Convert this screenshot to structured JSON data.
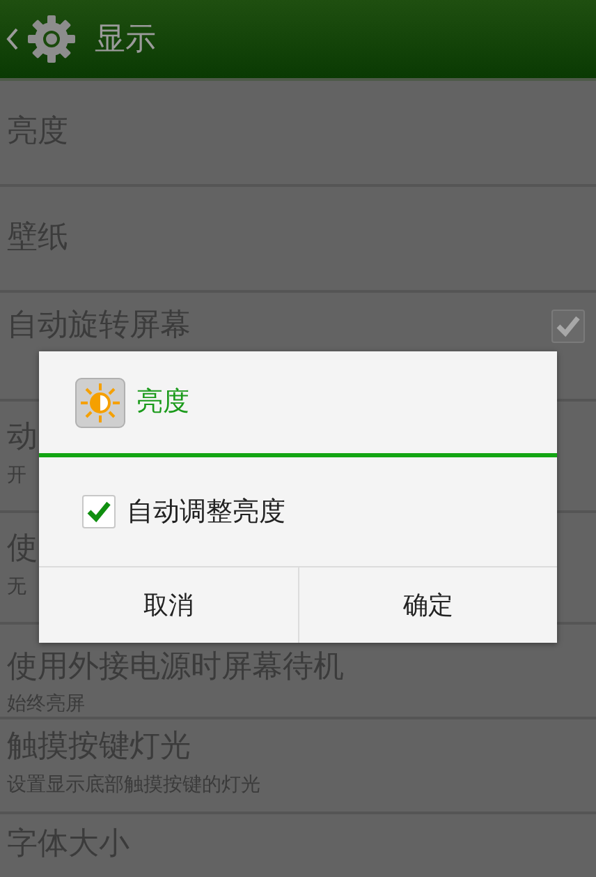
{
  "header": {
    "title": "显示"
  },
  "settings": [
    {
      "title": "亮度"
    },
    {
      "title": "壁纸"
    },
    {
      "title": "自动旋转屏幕",
      "checkbox": {
        "checked": true
      }
    },
    {
      "title": "动",
      "subtitle": "开"
    },
    {
      "title": "使",
      "subtitle": "无"
    },
    {
      "title": "使用外接电源时屏幕待机",
      "subtitle": "始终亮屏"
    },
    {
      "title": "触摸按键灯光",
      "subtitle": "设置显示底部触摸按键的灯光"
    },
    {
      "title": "字体大小"
    }
  ],
  "dialog": {
    "title": "亮度",
    "option": {
      "label": "自动调整亮度",
      "checked": true
    },
    "buttons": [
      "取消",
      "确定"
    ]
  }
}
